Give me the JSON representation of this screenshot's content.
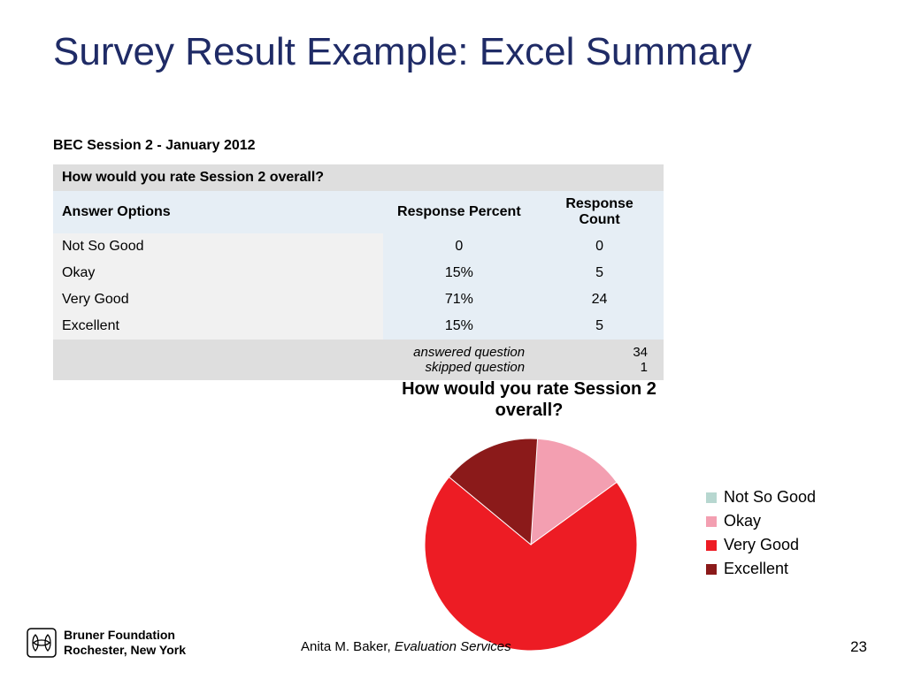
{
  "slide": {
    "title": "Survey Result Example: Excel Summary",
    "caption": "BEC Session 2 - January 2012",
    "page_number": "23"
  },
  "table": {
    "question": "How would you rate Session 2 overall?",
    "headers": {
      "opts": "Answer Options",
      "pct": "Response Percent",
      "cnt": "Response Count"
    },
    "rows": [
      {
        "label": "Not So Good",
        "pct": "0",
        "cnt": "0"
      },
      {
        "label": "Okay",
        "pct": "15%",
        "cnt": "5"
      },
      {
        "label": "Very Good",
        "pct": "71%",
        "cnt": "24"
      },
      {
        "label": "Excellent",
        "pct": "15%",
        "cnt": "5"
      }
    ],
    "answered_label": "answered question",
    "answered_value": "34",
    "skipped_label": "skipped question",
    "skipped_value": "1"
  },
  "legend": {
    "items": [
      "Not So Good",
      "Okay",
      "Very Good",
      "Excellent"
    ],
    "colors": [
      "#b7d7d0",
      "#f39fb1",
      "#ed1c24",
      "#8b1a1a"
    ]
  },
  "footer": {
    "org1": "Bruner Foundation",
    "org2": "Rochester, New York",
    "author": "Anita M. Baker, ",
    "author_role": "Evaluation Services"
  },
  "chart_data": {
    "type": "pie",
    "title": "How would you rate Session 2 overall?",
    "series": [
      {
        "name": "Not So Good",
        "value": 0,
        "percent": 0,
        "color": "#b7d7d0"
      },
      {
        "name": "Okay",
        "value": 5,
        "percent": 15,
        "color": "#f39fb1"
      },
      {
        "name": "Very Good",
        "value": 24,
        "percent": 71,
        "color": "#ed1c24"
      },
      {
        "name": "Excellent",
        "value": 5,
        "percent": 15,
        "color": "#8b1a1a"
      }
    ],
    "total": 34
  }
}
